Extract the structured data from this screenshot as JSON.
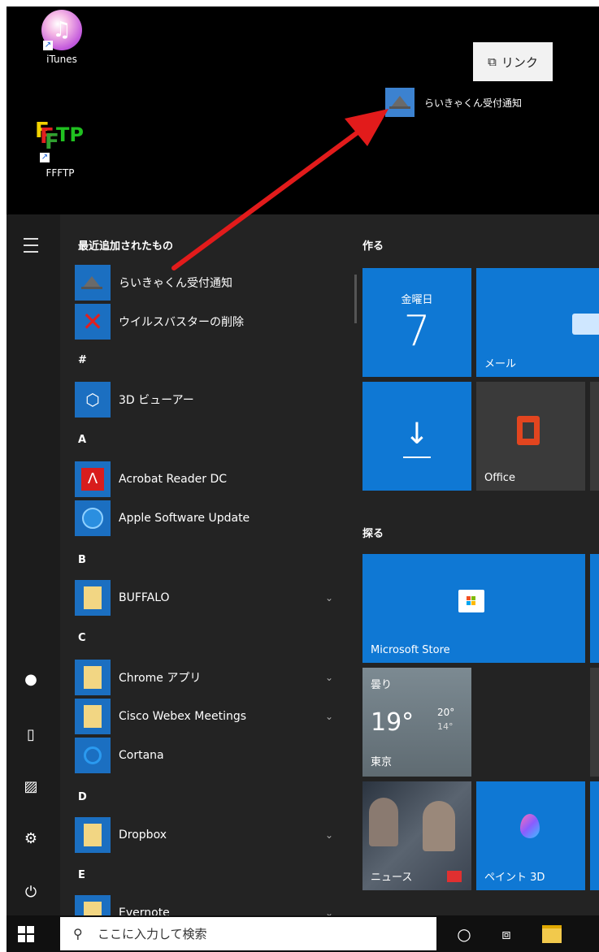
{
  "desktop": {
    "icons": [
      {
        "label": "iTunes"
      },
      {
        "label": "FFFTP"
      }
    ],
    "link_button": {
      "icon": "link-icon",
      "label": "リンク"
    },
    "dragged_item": {
      "label": "らいきゃくん受付通知"
    }
  },
  "start_menu": {
    "recently_added_label": "最近追加されたもの",
    "apps": [
      {
        "label": "らいきゃくん受付通知",
        "icon": "app-icon"
      },
      {
        "label": "ウイルスバスターの削除",
        "icon": "x-icon"
      },
      {
        "section": "#"
      },
      {
        "label": "3D ビューアー",
        "icon": "cube-icon"
      },
      {
        "section": "A"
      },
      {
        "label": "Acrobat Reader DC",
        "icon": "acrobat-icon"
      },
      {
        "label": "Apple Software Update",
        "icon": "apple-update-icon"
      },
      {
        "section": "B"
      },
      {
        "label": "BUFFALO",
        "icon": "folder-icon",
        "expandable": true
      },
      {
        "section": "C"
      },
      {
        "label": "Chrome アプリ",
        "icon": "folder-icon",
        "expandable": true
      },
      {
        "label": "Cisco Webex Meetings",
        "icon": "folder-icon",
        "expandable": true
      },
      {
        "label": "Cortana",
        "icon": "cortana-icon"
      },
      {
        "section": "D"
      },
      {
        "label": "Dropbox",
        "icon": "folder-icon",
        "expandable": true
      },
      {
        "section": "E"
      },
      {
        "label": "Evernote",
        "icon": "folder-icon",
        "expandable": true
      }
    ],
    "tile_groups": [
      {
        "label": "作る"
      },
      {
        "label": "探る"
      }
    ],
    "tiles": {
      "calendar": {
        "day": "金曜日",
        "date": "7"
      },
      "mail": {
        "label": "メール"
      },
      "download": {
        "label": ""
      },
      "office": {
        "label": "Office"
      },
      "store": {
        "label": "Microsoft Store"
      },
      "weather": {
        "condition": "曇り",
        "temp": "19°",
        "high": "20°",
        "low": "14°",
        "city": "東京"
      },
      "news": {
        "label": "ニュース"
      },
      "paint3d": {
        "label": "ペイント 3D"
      }
    }
  },
  "taskbar": {
    "search_placeholder": "ここに入力して検索"
  },
  "colors": {
    "tile_blue": "#0f78d4",
    "start_bg": "#232323",
    "arrow_red": "#e21b1b"
  }
}
